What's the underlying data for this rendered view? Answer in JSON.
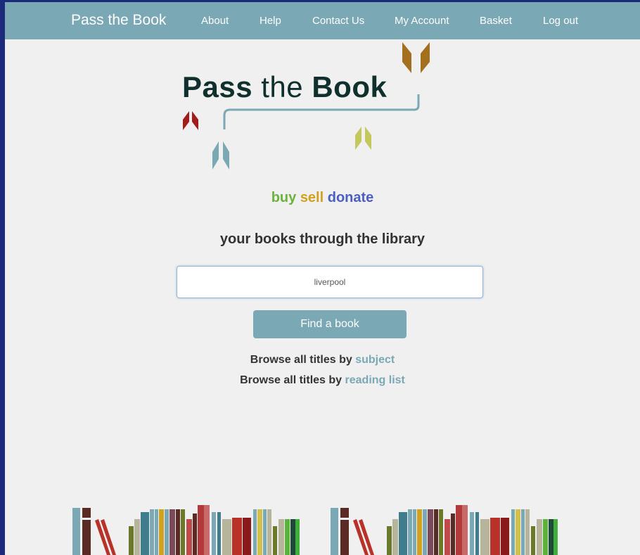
{
  "nav": {
    "brand": "Pass the Book",
    "items": [
      "About",
      "Help",
      "Contact Us",
      "My Account",
      "Basket",
      "Log out"
    ]
  },
  "logo": {
    "bold1": "Pass",
    "thin": "the",
    "bold2": "Book"
  },
  "tagline": {
    "buy": "buy",
    "sell": "sell",
    "donate": "donate"
  },
  "subtitle": "your books through the library",
  "search": {
    "value": "liverpool"
  },
  "find_button": "Find a book",
  "browse": [
    {
      "prefix": "Browse all titles by",
      "link": "subject"
    },
    {
      "prefix": "Browse all titles by",
      "link": "reading list"
    }
  ],
  "colors": {
    "accent": "#7aa8b5",
    "buy": "#6bb33b",
    "sell": "#d2a11e",
    "donate": "#4a5fc4",
    "outer": "#1b2a7a"
  }
}
